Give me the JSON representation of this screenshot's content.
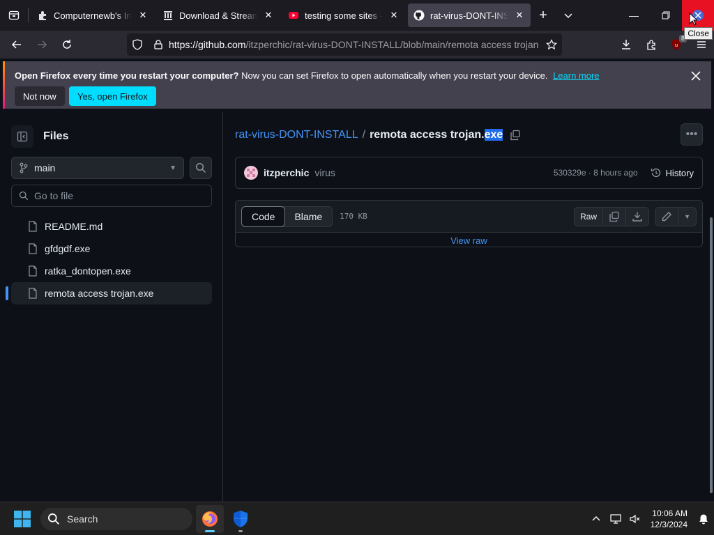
{
  "browser": {
    "tabs": [
      {
        "title": "Computernewb's Intern",
        "icon": "puzzle-icon"
      },
      {
        "title": "Download & Streaming",
        "icon": "archive-icon"
      },
      {
        "title": "testing some sites - Yo",
        "icon": "youtube-icon"
      },
      {
        "title": "rat-virus-DONT-INSTALL",
        "icon": "github-icon",
        "active": true
      }
    ],
    "close_tooltip": "Close",
    "url_host": "https://github.com",
    "url_path": "/itzperchic/rat-virus-DONT-INSTALL/blob/main/remota access trojan",
    "extension_badge": "8",
    "accent_color": "#00ddff"
  },
  "notification": {
    "bold": "Open Firefox every time you restart your computer?",
    "text": "Now you can set Firefox to open automatically when you restart your device.",
    "link": "Learn more",
    "not_now": "Not now",
    "yes": "Yes, open Firefox"
  },
  "sidebar": {
    "title": "Files",
    "branch": "main",
    "goto_placeholder": "Go to file",
    "files": [
      "README.md",
      "gfdgdf.exe",
      "ratka_dontopen.exe",
      "remota access trojan.exe"
    ],
    "active_index": 3
  },
  "main": {
    "repo": "rat-virus-DONT-INSTALL",
    "separator": "/",
    "file_base": "remota access trojan.",
    "file_ext_selected": "exe",
    "commit": {
      "author": "itzperchic",
      "message": "virus",
      "meta": "530329e · 8 hours ago",
      "history": "History"
    },
    "tabs": {
      "code": "Code",
      "blame": "Blame"
    },
    "size": "170 KB",
    "raw": "Raw",
    "view_raw": "View raw"
  },
  "taskbar": {
    "search": "Search",
    "time": "10:06 AM",
    "date": "12/3/2024"
  }
}
